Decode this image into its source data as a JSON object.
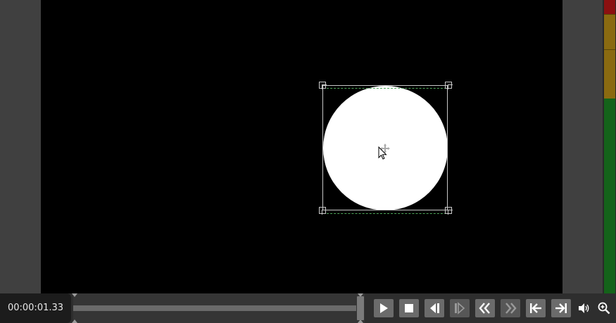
{
  "preview": {
    "canvas_color": "#000000",
    "shape_color": "#ffffff",
    "selection_color": "#c8c8c8",
    "guide_color": "#4fa65a"
  },
  "meter": {
    "colors": {
      "red": "#8b1010",
      "yellow": "#8a6a10",
      "green": "#14631a"
    }
  },
  "transport": {
    "timecode": "00:00:01.33",
    "playhead_progress": 1.0,
    "buttons": [
      {
        "name": "play-button",
        "icon": "play-icon"
      },
      {
        "name": "stop-button",
        "icon": "stop-icon"
      },
      {
        "name": "previous-frame-button",
        "icon": "step-back-icon"
      },
      {
        "name": "next-frame-button",
        "icon": "step-forward-icon"
      },
      {
        "name": "rewind-button",
        "icon": "rewind-icon"
      },
      {
        "name": "fast-forward-button",
        "icon": "fast-forward-icon"
      },
      {
        "name": "go-to-start-button",
        "icon": "go-to-start-icon"
      },
      {
        "name": "go-to-end-button",
        "icon": "go-to-end-icon"
      }
    ],
    "volume_icon": "volume-icon",
    "zoom_icon": "zoom-in-icon"
  }
}
